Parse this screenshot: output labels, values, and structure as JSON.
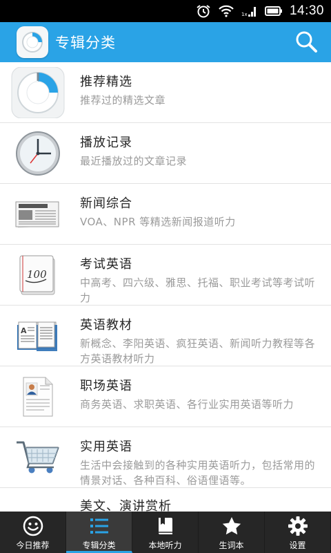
{
  "status_bar": {
    "time": "14:30",
    "icons": [
      "alarm-icon",
      "wifi-icon",
      "signal-icon",
      "battery-icon"
    ]
  },
  "app_bar": {
    "title": "专辑分类",
    "logo_icon": "app-logo-icon",
    "search_icon": "search-icon"
  },
  "categories": [
    {
      "title": "推荐精选",
      "desc": "推荐过的精选文章",
      "icon": "dial-icon"
    },
    {
      "title": "播放记录",
      "desc": "最近播放过的文章记录",
      "icon": "clock-icon"
    },
    {
      "title": "新闻综合",
      "desc": "VOA、NPR 等精选新闻报道听力",
      "icon": "newspaper-icon"
    },
    {
      "title": "考试英语",
      "desc": "中高考、四六级、雅思、托福、职业考试等考试听力",
      "icon": "exam-paper-icon"
    },
    {
      "title": "英语教材",
      "desc": "新概念、李阳英语、疯狂英语、新闻听力教程等各方英语教材听力",
      "icon": "open-book-icon"
    },
    {
      "title": "职场英语",
      "desc": "商务英语、求职英语、各行业实用英语等听力",
      "icon": "resume-icon"
    },
    {
      "title": "实用英语",
      "desc": "生活中会接触到的各种实用英语听力，包括常用的情景对话、各种百科、俗语俚语等。",
      "icon": "shopping-cart-icon"
    },
    {
      "title": "美文、演讲赏析",
      "desc": "",
      "icon": ""
    }
  ],
  "tabs": [
    {
      "label": "今日推荐",
      "icon": "smiley-icon",
      "active": false
    },
    {
      "label": "专辑分类",
      "icon": "list-icon",
      "active": true
    },
    {
      "label": "本地听力",
      "icon": "book-icon",
      "active": false
    },
    {
      "label": "生词本",
      "icon": "star-icon",
      "active": false
    },
    {
      "label": "设置",
      "icon": "gear-icon",
      "active": false
    }
  ],
  "colors": {
    "accent": "#2aa3e6",
    "tabbar": "#262626",
    "title_text": "#262626",
    "desc_text": "#9a9a9a"
  }
}
